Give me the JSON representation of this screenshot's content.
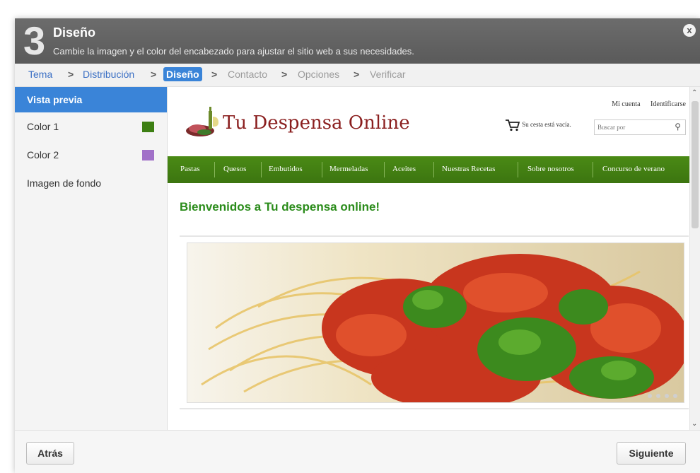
{
  "header": {
    "step_number": "3",
    "title": "Diseño",
    "subtitle": "Cambie la imagen y el color del encabezado para ajustar el sitio web a sus necesidades.",
    "close_label": "x"
  },
  "breadcrumb": {
    "items": [
      "Tema",
      "Distribución",
      "Diseño",
      "Contacto",
      "Opciones",
      "Verificar"
    ],
    "separator": ">",
    "active": "Diseño"
  },
  "sidebar": {
    "items": [
      {
        "label": "Vista previa",
        "active": true
      },
      {
        "label": "Color 1",
        "swatch": "#3d7f13"
      },
      {
        "label": "Color 2",
        "swatch": "#a171c8"
      },
      {
        "label": "Imagen de fondo"
      }
    ]
  },
  "preview": {
    "top_links": [
      "Mi cuenta",
      "Identificarse"
    ],
    "logo_text": "Tu Despensa Online",
    "cart_text": "Su cesta está vacía.",
    "search_placeholder": "Buscar por",
    "nav": [
      "Pastas",
      "Quesos",
      "Embutidos",
      "Mermeladas",
      "Aceites",
      "Nuestras Recetas",
      "Sobre nosotros",
      "Concurso de verano"
    ],
    "welcome": "Bienvenidos a Tu despensa online!",
    "colors": {
      "nav": "#3c7510",
      "welcome": "#2b8c1b",
      "logo": "#8a1e1e"
    }
  },
  "footer": {
    "back_label": "Atrás",
    "next_label": "Siguiente"
  }
}
